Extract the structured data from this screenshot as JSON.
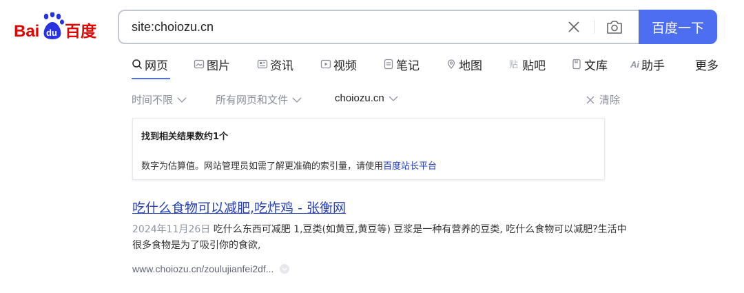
{
  "logo": {
    "left_text": "Bai",
    "paw_text": "du",
    "right_text": "百度"
  },
  "search": {
    "query": "site:choiozu.cn",
    "button_label": "百度一下"
  },
  "tabs": [
    {
      "label": "网页",
      "icon": "search-icon",
      "active": true
    },
    {
      "label": "图片",
      "icon": "image-icon"
    },
    {
      "label": "资讯",
      "icon": "news-icon"
    },
    {
      "label": "视频",
      "icon": "video-icon"
    },
    {
      "label": "笔记",
      "icon": "note-icon"
    },
    {
      "label": "地图",
      "icon": "map-pin-icon"
    },
    {
      "label": "贴吧",
      "icon": "tieba-icon"
    },
    {
      "label": "文库",
      "icon": "doc-icon"
    },
    {
      "label": "助手",
      "icon": "ai-icon",
      "icon_text": "Ai"
    },
    {
      "label": "更多"
    }
  ],
  "filters": {
    "time": "时间不限",
    "type": "所有网页和文件",
    "site": "choiozu.cn",
    "clear": "清除"
  },
  "info": {
    "title": "找到相关结果数约1个",
    "desc_prefix": "数字为估算值。网站管理员如需了解更准确的索引量，请使用",
    "desc_link": "百度站长平台"
  },
  "result": {
    "title": "吃什么食物可以减肥,吃炸鸡 - 张衡网",
    "date": "2024年11月26日",
    "abstract": "吃什么东西可减肥 1,豆类(如黄豆,黄豆等) 豆浆是一种有营养的豆类, 吃什么食物可以减肥?生活中很多食物是为了吸引你的食欲,",
    "url": "www.choiozu.cn/zoulujianfei2df..."
  },
  "colors": {
    "brand_red": "#e10602",
    "brand_blue": "#2932e1",
    "button_blue": "#4e6ef2",
    "link_blue": "#2440b3"
  }
}
